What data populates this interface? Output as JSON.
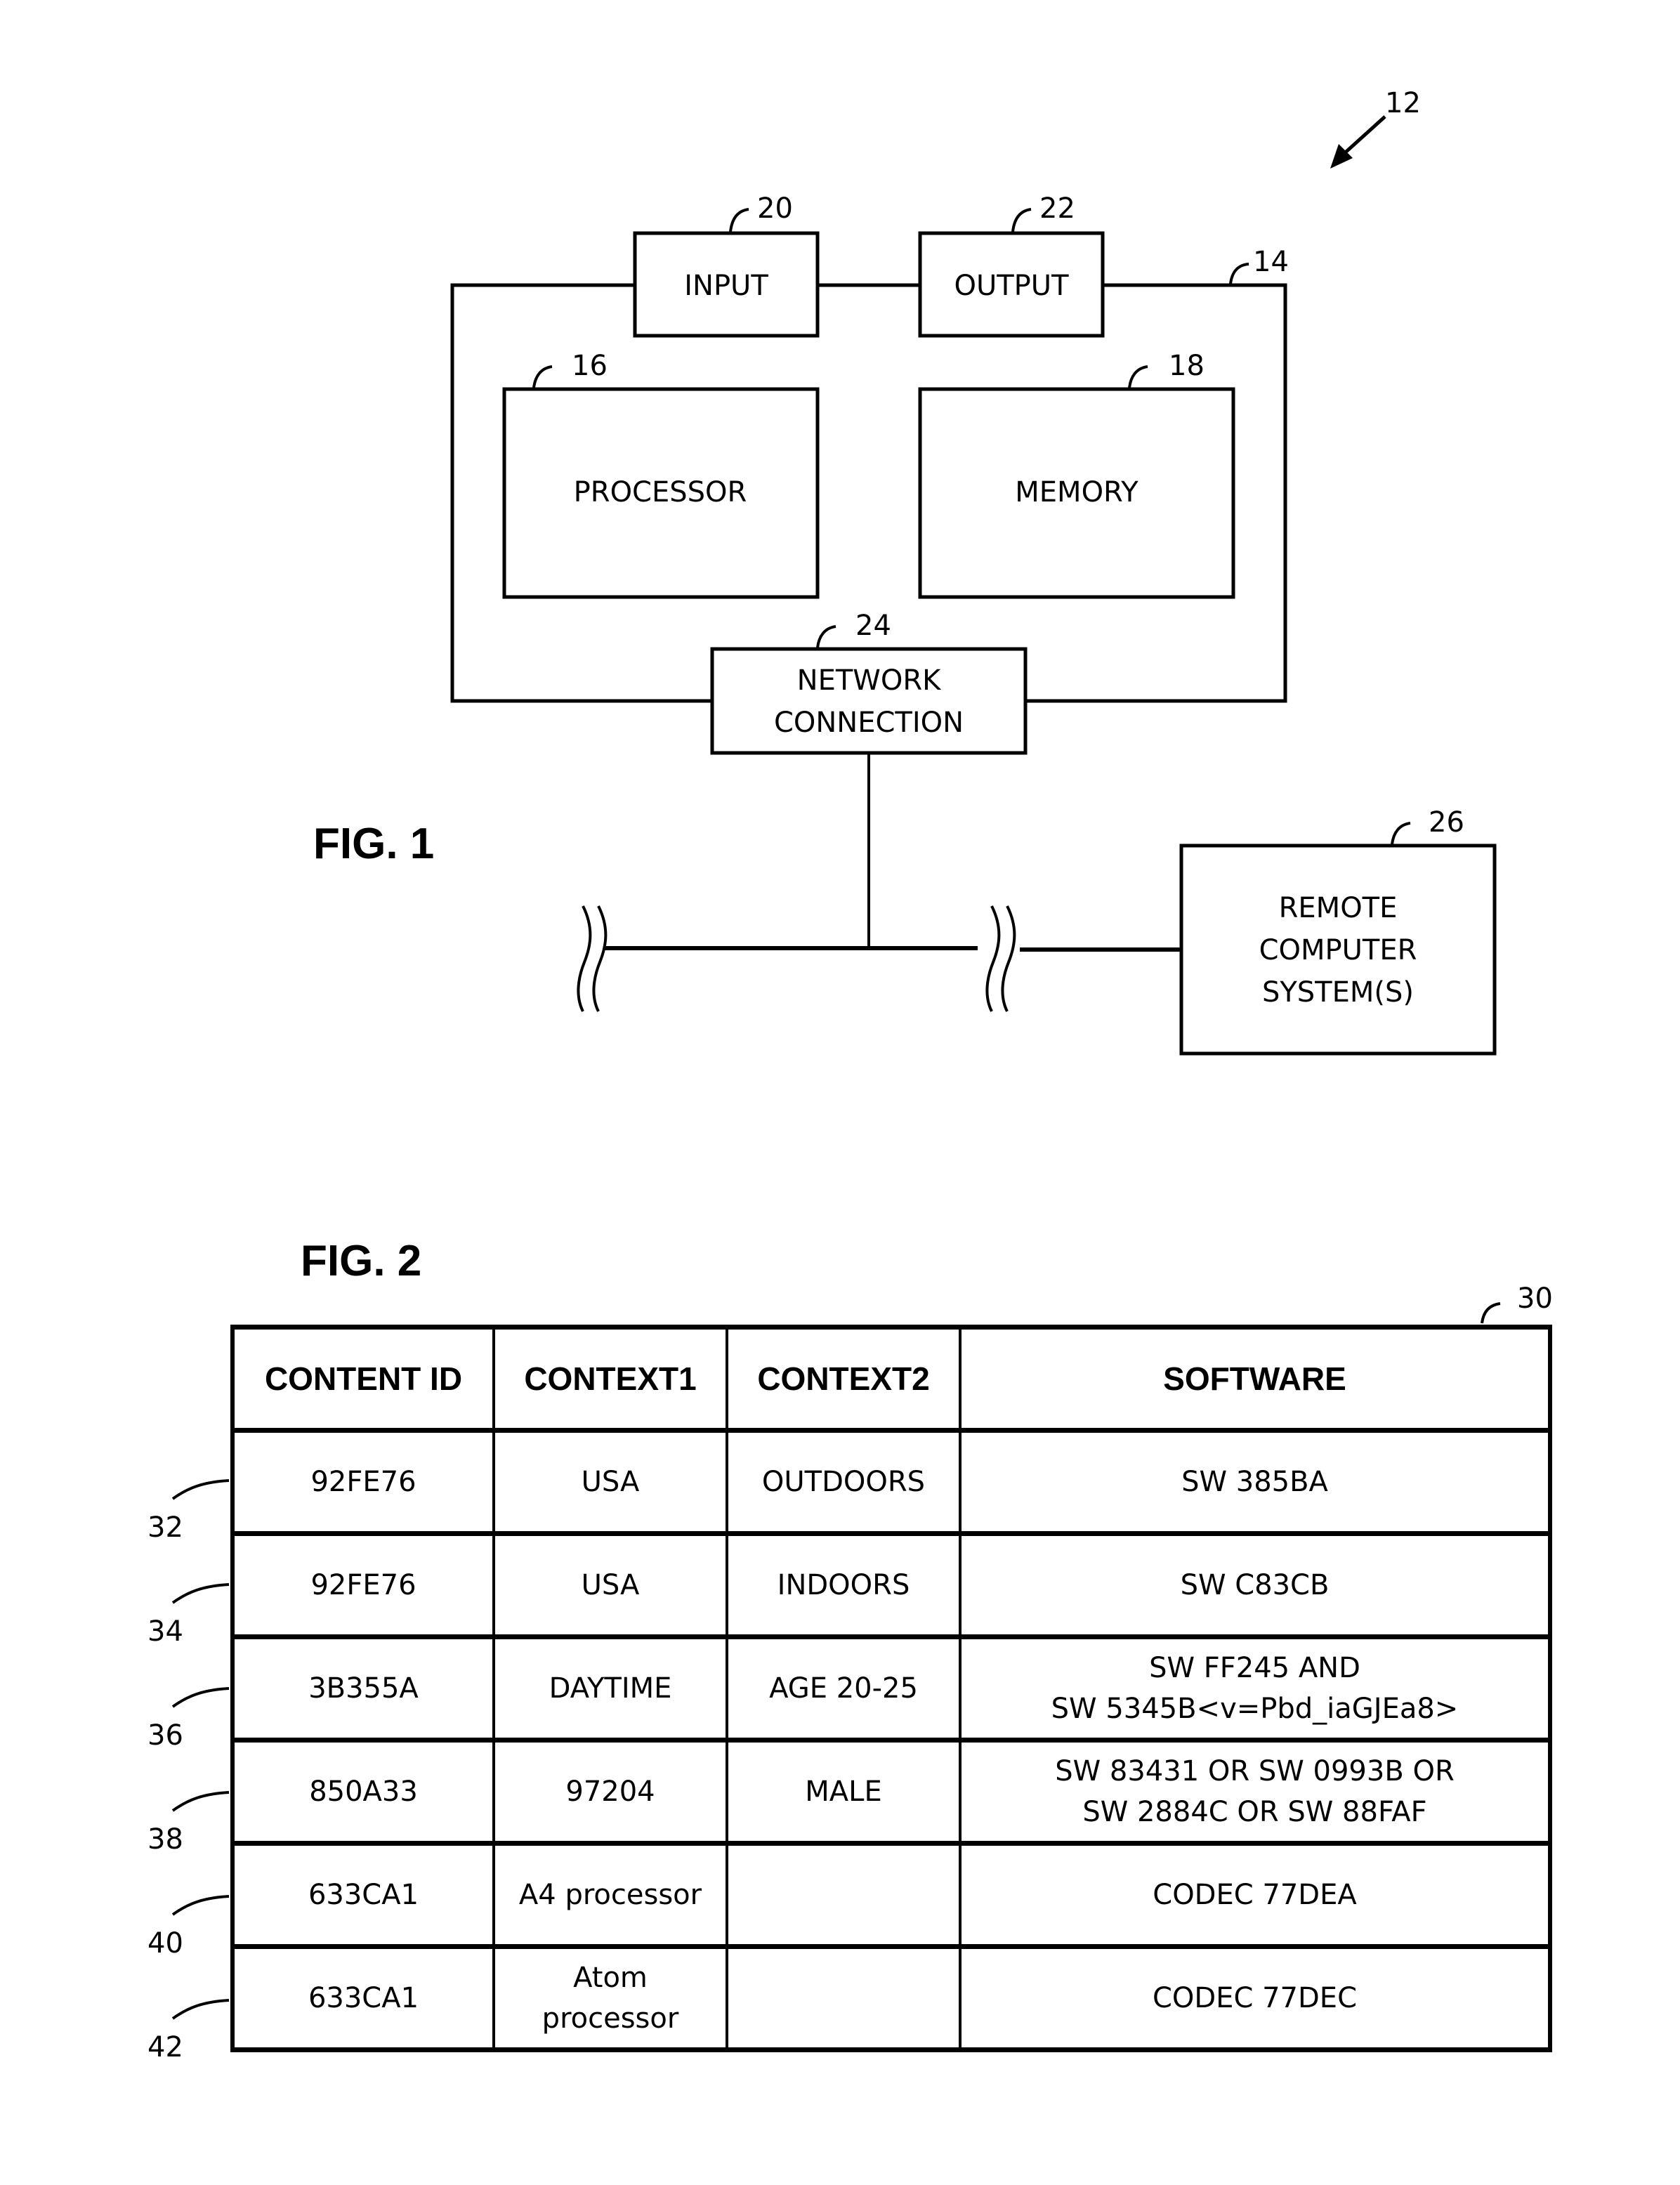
{
  "fig1": {
    "title": "FIG. 1",
    "system_ref": "12",
    "computer_ref": "14",
    "blocks": {
      "input": {
        "label": "INPUT",
        "ref": "20"
      },
      "output": {
        "label": "OUTPUT",
        "ref": "22"
      },
      "processor": {
        "label": "PROCESSOR",
        "ref": "16"
      },
      "memory": {
        "label": "MEMORY",
        "ref": "18"
      },
      "network": {
        "label_line1": "NETWORK",
        "label_line2": "CONNECTION",
        "ref": "24"
      },
      "remote": {
        "label_line1": "REMOTE",
        "label_line2": "COMPUTER",
        "label_line3": "SYSTEM(S)",
        "ref": "26"
      }
    }
  },
  "fig2": {
    "title": "FIG. 2",
    "table_ref": "30",
    "columns": [
      "CONTENT ID",
      "CONTEXT1",
      "CONTEXT2",
      "SOFTWARE"
    ],
    "rows": [
      {
        "ref": "32",
        "content_id": "92FE76",
        "context1": "USA",
        "context2": "OUTDOORS",
        "software_line1": "SW 385BA",
        "software_line2": ""
      },
      {
        "ref": "34",
        "content_id": "92FE76",
        "context1": "USA",
        "context2": "INDOORS",
        "software_line1": "SW C83CB",
        "software_line2": ""
      },
      {
        "ref": "36",
        "content_id": "3B355A",
        "context1": "DAYTIME",
        "context2": "AGE 20-25",
        "software_line1": "SW FF245 AND",
        "software_line2": "SW 5345B<v=Pbd_iaGJEa8>"
      },
      {
        "ref": "38",
        "content_id": "850A33",
        "context1": "97204",
        "context2": "MALE",
        "software_line1": "SW 83431 OR SW 0993B OR",
        "software_line2": "SW 2884C OR SW 88FAF"
      },
      {
        "ref": "40",
        "content_id": "633CA1",
        "context1_line1": "A4 processor",
        "context1_line2": "",
        "context2": "",
        "software_line1": "CODEC 77DEA",
        "software_line2": ""
      },
      {
        "ref": "42",
        "content_id": "633CA1",
        "context1_line1": "Atom",
        "context1_line2": "processor",
        "context2": "",
        "software_line1": "CODEC 77DEC",
        "software_line2": ""
      }
    ]
  }
}
